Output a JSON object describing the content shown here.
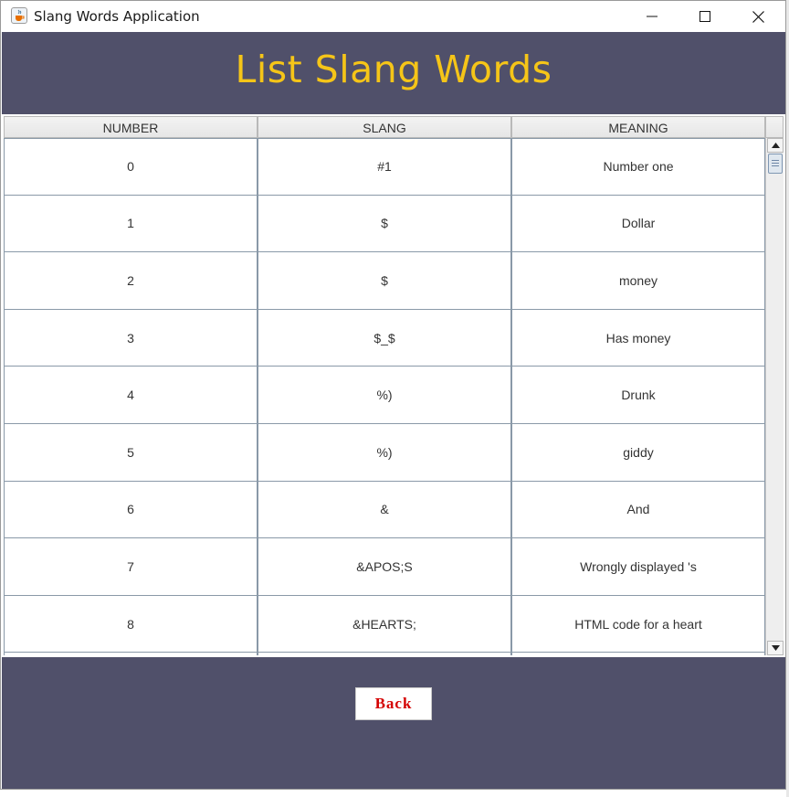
{
  "window": {
    "title": "Slang Words Application",
    "icon": "java-cup-icon"
  },
  "header": {
    "title": "List Slang Words",
    "title_color": "#f5c518",
    "background": "#50506a"
  },
  "table": {
    "columns": [
      "NUMBER",
      "SLANG",
      "MEANING"
    ],
    "rows": [
      {
        "number": "0",
        "slang": "#1",
        "meaning": "Number one"
      },
      {
        "number": "1",
        "slang": "$",
        "meaning": "Dollar"
      },
      {
        "number": "2",
        "slang": "$",
        "meaning": "money"
      },
      {
        "number": "3",
        "slang": "$_$",
        "meaning": "Has money"
      },
      {
        "number": "4",
        "slang": "%)",
        "meaning": "Drunk"
      },
      {
        "number": "5",
        "slang": "%)",
        "meaning": "giddy"
      },
      {
        "number": "6",
        "slang": "&",
        "meaning": "And"
      },
      {
        "number": "7",
        "slang": "&APOS;S",
        "meaning": "Wrongly displayed 's"
      },
      {
        "number": "8",
        "slang": "&HEARTS;",
        "meaning": "HTML code for a heart"
      }
    ]
  },
  "footer": {
    "back_label": "Back",
    "back_color": "#d40000"
  }
}
